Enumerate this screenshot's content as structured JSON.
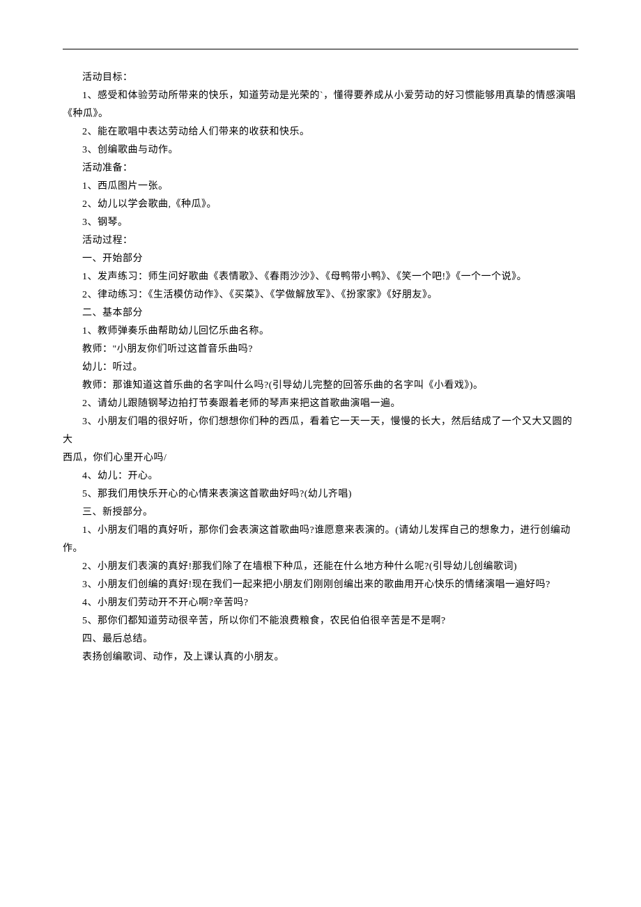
{
  "lines": [
    "活动目标：",
    "1、感受和体验劳动所带来的快乐，知道劳动是光荣的`，懂得要养成从小爱劳动的好习惯能够用真挚的情感演唱《种瓜》。",
    "2、能在歌唱中表达劳动给人们带来的收获和快乐。",
    "3、创编歌曲与动作。",
    "活动准备：",
    "1、西瓜图片一张。",
    "2、幼儿以学会歌曲,《种瓜》。",
    "3、钢琴。",
    "活动过程：",
    "一、开始部分",
    "1、发声练习：师生问好歌曲《表情歌》、《春雨沙沙》、《母鸭带小鸭》、《笑一个吧!》《一个一个说》。",
    "2、律动练习：《生活模仿动作》、《买菜》、《学做解放军》、《扮家家》《好朋友》。",
    "二、基本部分",
    "1、教师弹奏乐曲帮助幼儿回忆乐曲名称。",
    "教师：\"小朋友你们听过这首音乐曲吗?",
    "幼儿：听过。",
    "教师：那谁知道这首乐曲的名字叫什么吗?(引导幼儿完整的回答乐曲的名字叫《小看戏》)。",
    "2、请幼儿跟随钢琴边拍打节奏跟着老师的琴声来把这首歌曲演唱一遍。",
    "3、小朋友们唱的很好听，你们想想你们种的西瓜，看着它一天一天，慢慢的长大，然后结成了一个又大又圆的大西瓜，你们心里开心吗/",
    "4、幼儿：开心。",
    "5、那我们用快乐开心的心情来表演这首歌曲好吗?(幼儿齐唱)",
    "三、新授部分。",
    "1、小朋友们唱的真好听，那你们会表演这首歌曲吗?谁愿意来表演的。(请幼儿发挥自己的想象力，进行创编动作。",
    "2、小朋友们表演的真好!那我们除了在墙根下种瓜，还能在什么地方种什么呢?(引导幼儿创编歌词)",
    "3、小朋友们创编的真好!现在我们一起来把小朋友们刚刚创编出来的歌曲用开心快乐的情绪演唱一遍好吗?",
    "4、小朋友们劳动开不开心啊?辛苦吗?",
    "5、那你们都知道劳动很辛苦，所以你们不能浪费粮食，农民伯伯很辛苦是不是啊?",
    "四、最后总结。",
    "表扬创编歌词、动作，及上课认真的小朋友。"
  ],
  "outdent_lines": [
    1,
    18
  ]
}
